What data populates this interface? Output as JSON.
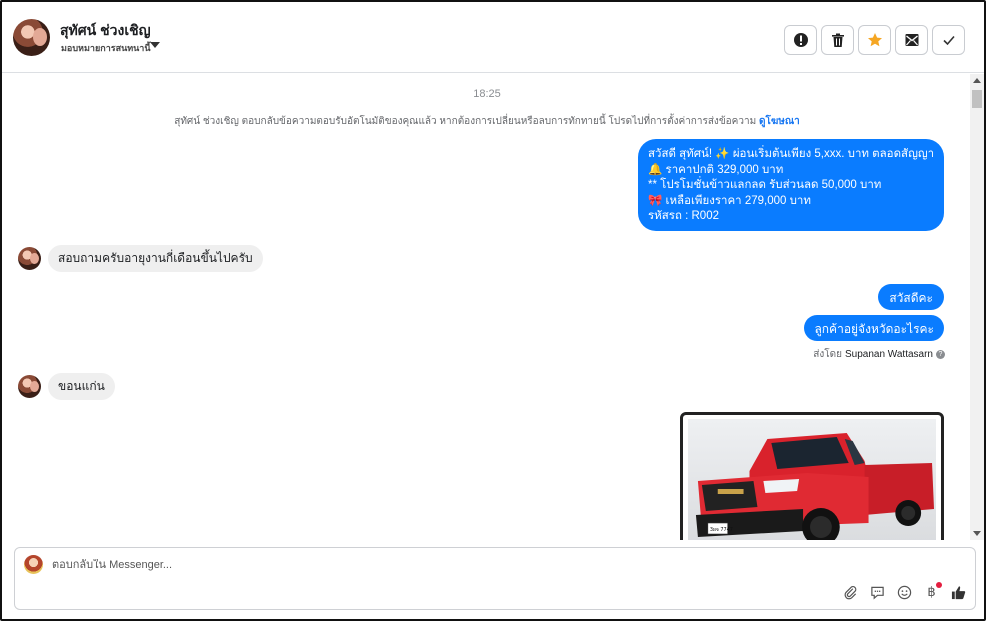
{
  "header": {
    "contact_name": "สุทัศน์ ช่วงเชิญ",
    "assign_label": "มอบหมายการสนทนานี้",
    "actions": [
      {
        "name": "report-button",
        "icon": "alert-icon"
      },
      {
        "name": "delete-button",
        "icon": "trash-icon"
      },
      {
        "name": "star-button",
        "icon": "star-icon"
      },
      {
        "name": "mark-unread-button",
        "icon": "envelope-icon"
      },
      {
        "name": "mark-done-button",
        "icon": "check-icon"
      }
    ]
  },
  "chat": {
    "time": "18:25",
    "notice_text": "สุทัศน์ ช่วงเชิญ ตอบกลับข้อความตอบรับอัตโนมัติของคุณแล้ว หากต้องการเปลี่ยนหรือลบการทักทายนี้ โปรดไปที่การตั้งค่าการส่งข้อความ",
    "notice_link": "ดูโฆษณา",
    "promo_lines": [
      "สวัสดี สุทัศน์! ✨  ผ่อนเริ่มต้นเพียง 5,xxx. บาท ตลอดสัญญา",
      "🔔 ราคาปกติ  329,000 บาท",
      "** โปรโมชั่นข้าวแลกลด รับส่วนลด 50,000 บาท",
      "🎀  เหลือเพียงราคา 279,000 บาท",
      " รหัสรถ : R002"
    ],
    "incoming_1": "สอบถามครับอายุงานกี่เดือนขึ้นไปครับ",
    "outgoing_hello": "สวัสดีคะ",
    "outgoing_province": "ลูกค้าอยู่จังหวัดอะไรคะ",
    "sent_by_prefix": "ส่งโดย",
    "sent_by_name": "Supanan Wattasarn",
    "incoming_2": "ขอนแก่น",
    "plate_text": "3ผจ 7747"
  },
  "composer": {
    "placeholder": "ตอบกลับใน Messenger...",
    "tools": [
      "paperclip-icon",
      "saved-reply-icon",
      "emoji-icon",
      "baht-icon",
      "thumbs-up-icon"
    ],
    "baht_symbol": "฿"
  },
  "colors": {
    "accent": "#0a7cff",
    "star": "#f5a623",
    "link": "#1877f2"
  }
}
